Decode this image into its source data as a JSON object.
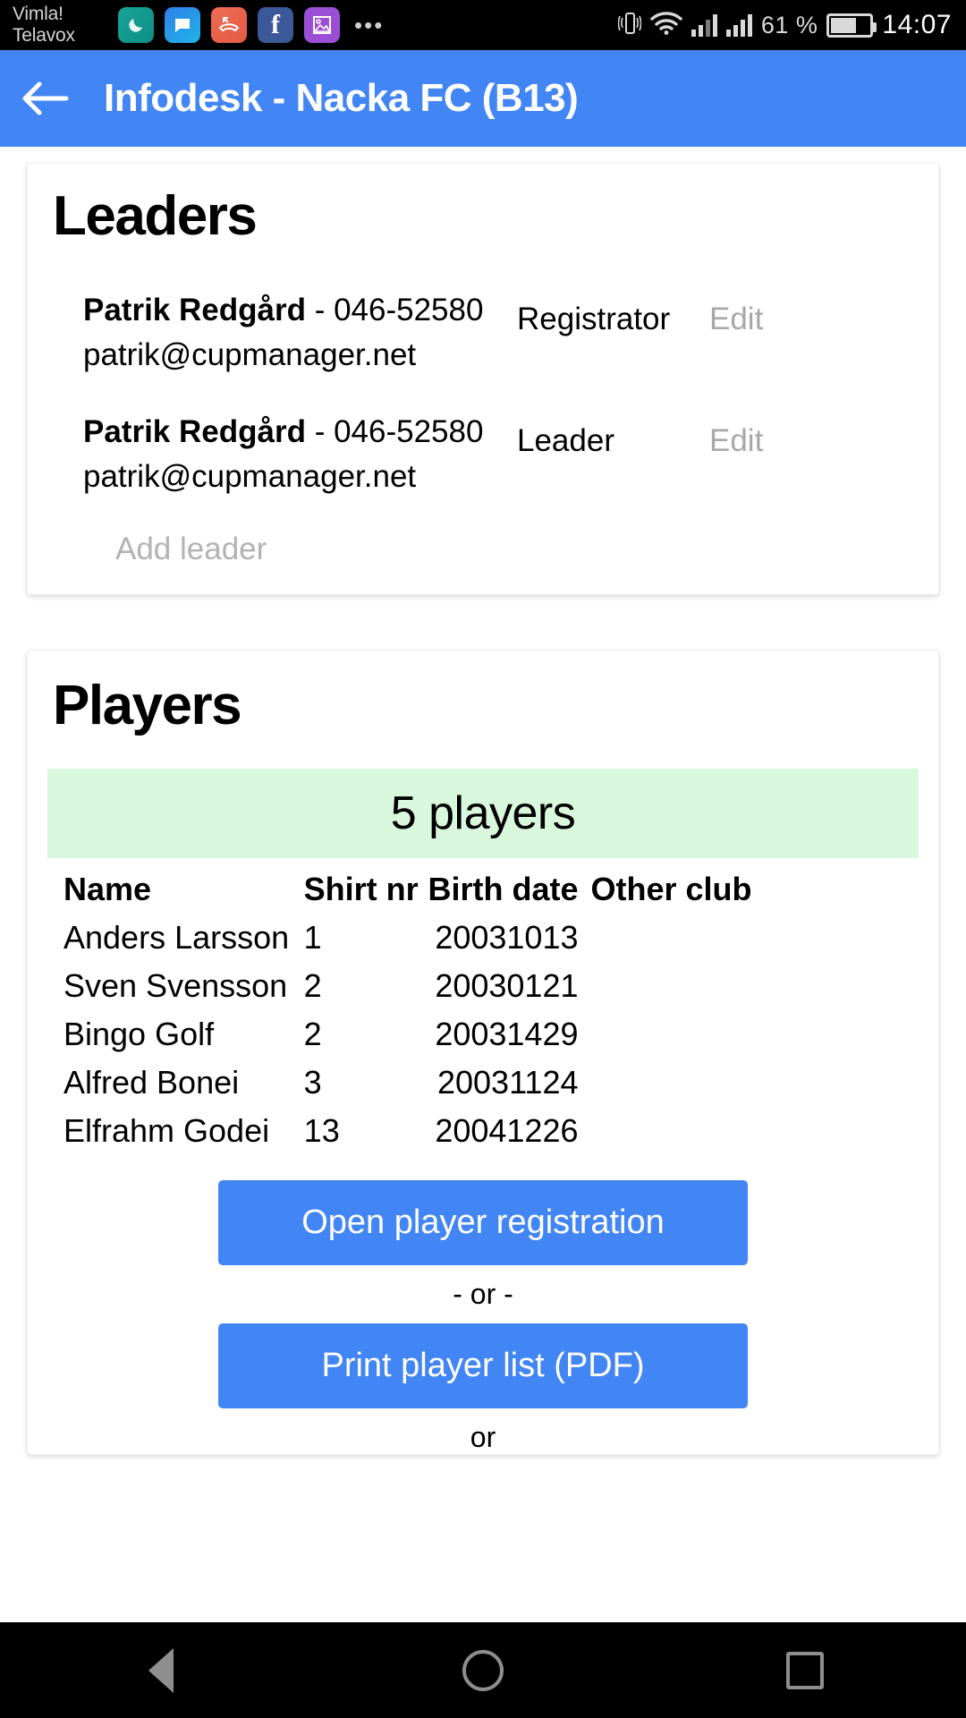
{
  "status_bar": {
    "carrier_line1": "Vimla!",
    "carrier_line2": "Telavox",
    "notification_icons": [
      "moon-icon",
      "chat-bubble-icon",
      "missed-call-icon",
      "facebook-icon",
      "gallery-icon"
    ],
    "more_icon": "•••",
    "vibrate_icon": "vibrate-icon",
    "wifi_icon": "wifi-icon",
    "battery_percent": "61 %",
    "clock": "14:07"
  },
  "appbar": {
    "back_icon": "back-arrow-icon",
    "title": "Infodesk - Nacka FC (B13)",
    "background_color": "#4285f4"
  },
  "leaders_card": {
    "title": "Leaders",
    "rows": [
      {
        "name": "Patrik Redgård",
        "separator": " - ",
        "phone": "046-52580",
        "email": "patrik@cupmanager.net",
        "role": "Registrator",
        "edit_label": "Edit"
      },
      {
        "name": "Patrik Redgård",
        "separator": " - ",
        "phone": "046-52580",
        "email": "patrik@cupmanager.net",
        "role": "Leader",
        "edit_label": "Edit"
      }
    ],
    "add_leader_label": "Add leader"
  },
  "players_card": {
    "title": "Players",
    "count_banner": "5 players",
    "banner_color": "#d9f7dc",
    "columns": [
      "Name",
      "Shirt nr",
      "Birth date",
      "Other club"
    ],
    "rows": [
      {
        "name": "Anders Larsson",
        "shirt": "1",
        "birth": "20031013",
        "other_club": ""
      },
      {
        "name": "Sven Svensson",
        "shirt": "2",
        "birth": "20030121",
        "other_club": ""
      },
      {
        "name": "Bingo Golf",
        "shirt": "2",
        "birth": "20031429",
        "other_club": ""
      },
      {
        "name": "Alfred Bonei",
        "shirt": "3",
        "birth": "20031124",
        "other_club": ""
      },
      {
        "name": "Elfrahm Godei",
        "shirt": "13",
        "birth": "20041226",
        "other_club": ""
      }
    ],
    "open_registration_label": "Open player registration",
    "or_separator": "- or -",
    "print_pdf_label": "Print player list (PDF)",
    "or_separator_bottom": "or",
    "button_color": "#4285f4"
  },
  "nav_bar": {
    "back_icon": "nav-back-triangle-icon",
    "home_icon": "nav-home-circle-icon",
    "recents_icon": "nav-recents-square-icon"
  }
}
